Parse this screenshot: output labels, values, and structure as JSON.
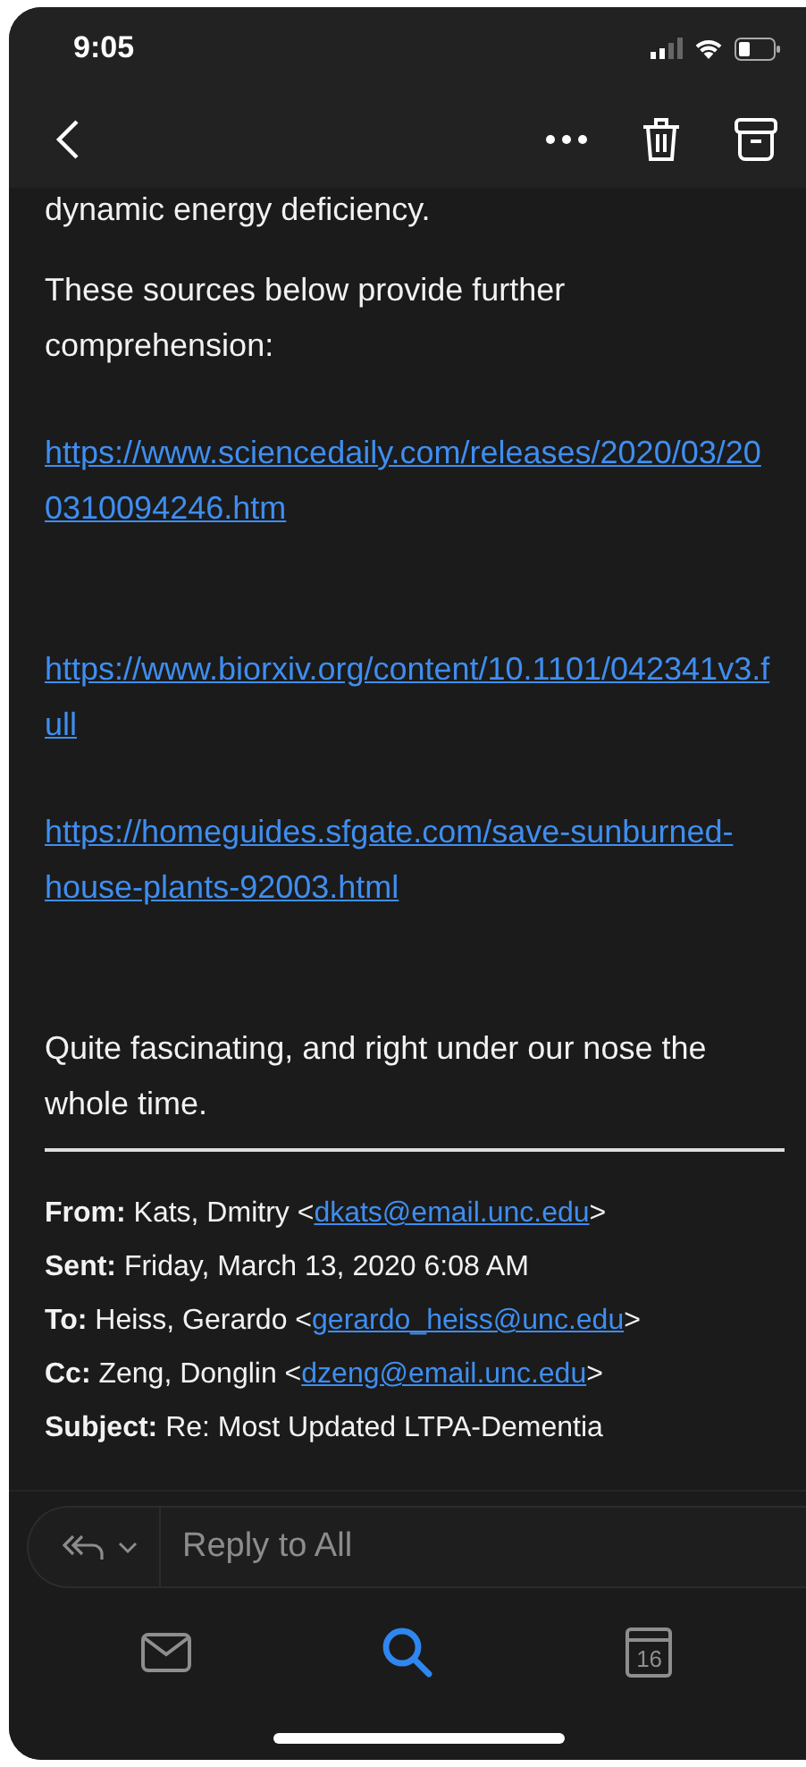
{
  "status_bar": {
    "time": "9:05"
  },
  "body": {
    "paragraphs": [
      {
        "kind": "text",
        "text": "dynamic energy deficiency."
      },
      {
        "kind": "text",
        "text": "These sources below provide further comprehension:"
      },
      {
        "kind": "link",
        "text": "https://www.sciencedaily.com/releases/2020/03/200310094246.htm"
      },
      {
        "kind": "gap"
      },
      {
        "kind": "link",
        "text": "https://www.biorxiv.org/content/10.1101/042341v3.full"
      },
      {
        "kind": "link",
        "text": "https://homeguides.sfgate.com/save-sunburned-house-plants-92003.html"
      },
      {
        "kind": "gap"
      },
      {
        "kind": "text",
        "text": "Quite fascinating, and right under our nose the whole time."
      }
    ],
    "header": [
      {
        "label": "From:",
        "text": "Kats, Dmitry <",
        "link": "dkats@email.unc.edu",
        "after": ">"
      },
      {
        "label": "Sent:",
        "text": "Friday, March 13, 2020 6:08 AM"
      },
      {
        "label": "To:",
        "text": "Heiss, Gerardo <",
        "link": "gerardo_heiss@unc.edu",
        "after": ">"
      },
      {
        "label": "Cc:",
        "text": "Zeng, Donglin <",
        "link": "dzeng@email.unc.edu",
        "after": ">"
      },
      {
        "label": "Subject:",
        "text": "Re: Most Updated LTPA-Dementia"
      }
    ]
  },
  "reply_bar": {
    "label": "Reply to All"
  },
  "tab_bar": [
    {
      "kind": "mail",
      "selected": false
    },
    {
      "kind": "search",
      "selected": true
    },
    {
      "kind": "calendar",
      "label": "16",
      "selected": false
    }
  ]
}
